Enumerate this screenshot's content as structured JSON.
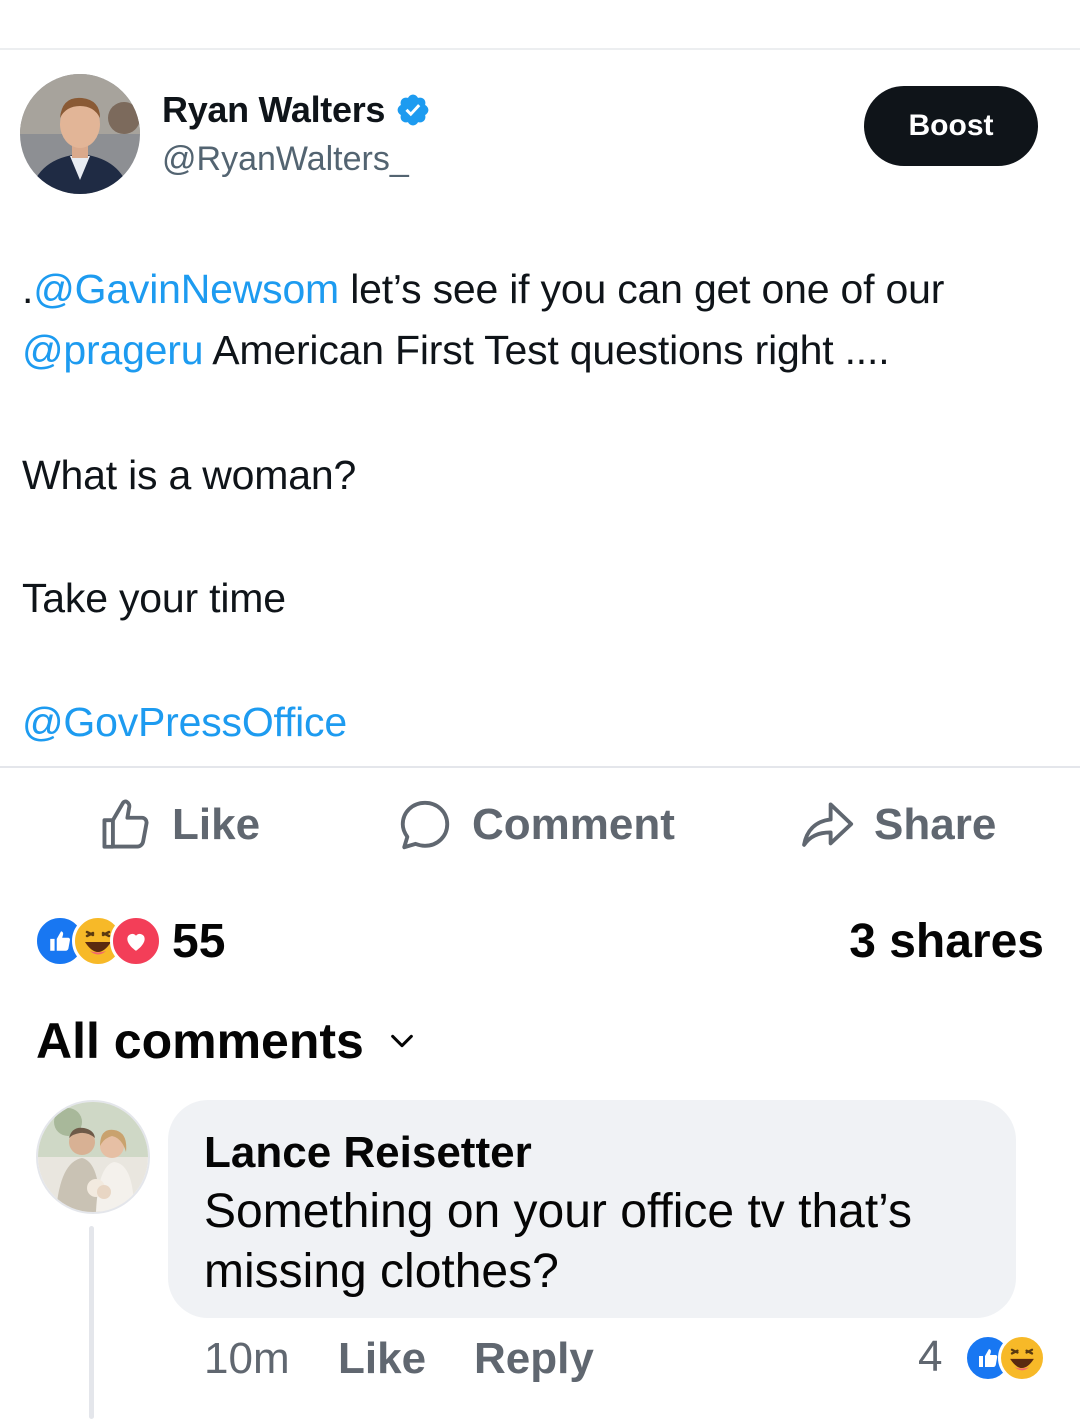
{
  "tweet": {
    "author_name": "Ryan Walters",
    "handle": "@RyanWalters_",
    "boost_label": "Boost",
    "line1": [
      {
        "text": ".",
        "mention": false
      },
      {
        "text": "@GavinNewsom",
        "mention": true
      },
      {
        "text": " let’s see if you can get one of our",
        "mention": false
      }
    ],
    "line2": [
      {
        "text": "@prageru",
        "mention": true
      },
      {
        "text": " American First Test questions right ....",
        "mention": false
      }
    ],
    "line3": "What is a woman?",
    "line4": "Take your time",
    "line5": "@GovPressOffice"
  },
  "actions": {
    "like": "Like",
    "comment": "Comment",
    "share": "Share"
  },
  "stats": {
    "reaction_count": "55",
    "shares": "3 shares",
    "reactions": [
      "like-reaction",
      "haha-reaction",
      "love-reaction"
    ]
  },
  "comments_filter": {
    "label": "All comments"
  },
  "comment": {
    "author": "Lance Reisetter",
    "text": "Something on your office tv that’s missing clothes?",
    "time": "10m",
    "like": "Like",
    "reply": "Reply",
    "reaction_count": "4",
    "reactions": [
      "like-reaction",
      "haha-reaction"
    ]
  },
  "colors": {
    "mention": "#1d9bf0",
    "facebook_blue": "#1877f2",
    "love_red": "#f33e58",
    "haha_yellow": "#f7b928",
    "bubble_bg": "#f0f2f5",
    "boost_bg": "#0f1419"
  }
}
